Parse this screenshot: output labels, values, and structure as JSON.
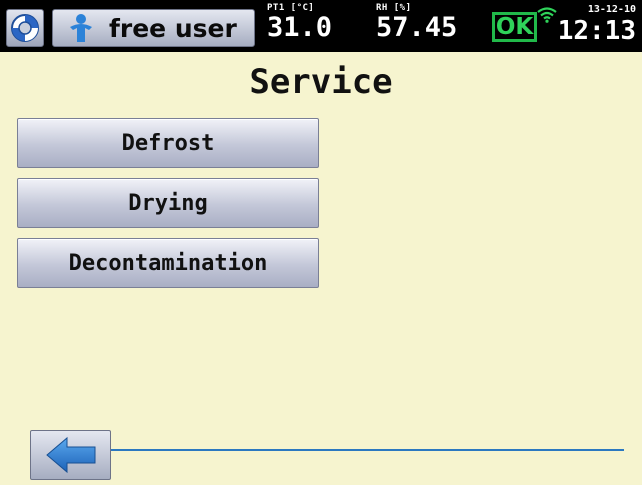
{
  "topbar": {
    "user_label": "free user",
    "pt1": {
      "label": "PT1 [°C]",
      "value": "31.0"
    },
    "rh": {
      "label": "RH [%]",
      "value": "57.45"
    },
    "status": "OK",
    "date": "13-12-10",
    "time": "12:13",
    "icons": [
      "lifebuoy-icon",
      "person-icon",
      "wifi-icon"
    ]
  },
  "page": {
    "title": "Service",
    "buttons": [
      "Defrost",
      "Drying",
      "Decontamination"
    ],
    "back_icon": "arrow-left-icon"
  },
  "colors": {
    "background": "#f6f4cf",
    "topbar": "#000000",
    "ok_green": "#21b94a",
    "accent_blue": "#2b78c0"
  }
}
